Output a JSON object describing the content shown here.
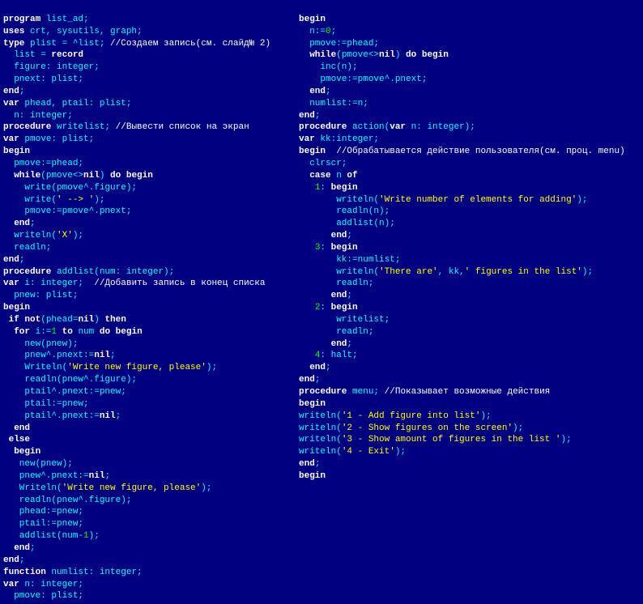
{
  "comments": {
    "c1": "//Создаем запись(см. слайд№ 2)",
    "c2": "//Вывести список на экран",
    "c3": "//Добавить запись в конец списка",
    "c4": "//Обрабатывается действие пользователя(см. проц. menu)",
    "c5": "//Показывает возможные действия"
  },
  "code_left": [
    "program list_ad;",
    "uses crt, sysutils, graph;",
    "type plist = ^list; ",
    "  list = record",
    "  figure: integer;",
    "  pnext: plist;",
    "end;",
    "var phead, ptail: plist;",
    "  n: integer;",
    "procedure writelist; ",
    "var pmove: plist;",
    "begin",
    "  pmove:=phead;",
    "  while(pmove<>nil) do begin",
    "    write(pmove^.figure);",
    "    write(' --> ');",
    "    pmove:=pmove^.pnext;",
    "  end;",
    "  writeln('X');",
    "  readln;",
    "end;",
    "procedure addlist(num: integer);",
    "var i: integer;  ",
    "  pnew: plist;",
    "begin",
    " if not(phead=nil) then",
    "  for i:=1 to num do begin",
    "    new(pnew);",
    "    pnew^.pnext:=nil;",
    "    Writeln('Write new figure, please');",
    "    readln(pnew^.figure);",
    "    ptail^.pnext:=pnew;",
    "    ptail:=pnew;",
    "    ptail^.pnext:=nil;",
    "  end",
    " else",
    "  begin",
    "   new(pnew);",
    "   pnew^.pnext:=nil;",
    "   Writeln('Write new figure, please');",
    "   readln(pnew^.figure);",
    "   phead:=pnew;",
    "   ptail:=pnew;",
    "   addlist(num-1);",
    "  end;",
    "end;",
    "function numlist: integer;",
    "var n: integer;",
    "  pmove: plist;"
  ],
  "code_right": [
    "begin",
    "  n:=0;",
    "  pmove:=phead;",
    "  while(pmove<>nil) do begin",
    "    inc(n);",
    "    pmove:=pmove^.pnext;",
    "  end;",
    "  numlist:=n;",
    "end;",
    "procedure action(var n: integer);",
    "var kk:integer;",
    "begin  ",
    "  clrscr;",
    "  case n of",
    "   1: begin",
    "       writeln('Write number of elements for adding');",
    "       readln(n);",
    "       addlist(n);",
    "      end;",
    "   3: begin",
    "       kk:=numlist;",
    "       writeln('There are', kk,' figures in the list');",
    "       readln;",
    "      end;",
    "   2: begin",
    "       writelist;",
    "       readln;",
    "      end;",
    "   4: halt;",
    "  end;",
    "end;",
    "procedure menu; ",
    "begin",
    "writeln('1 - Add figure into list');",
    "writeln('2 - Show figures on the screen');",
    "writeln('3 - Show amount of figures in the list ');",
    "writeln('4 - Exit');",
    "end;",
    "begin"
  ]
}
